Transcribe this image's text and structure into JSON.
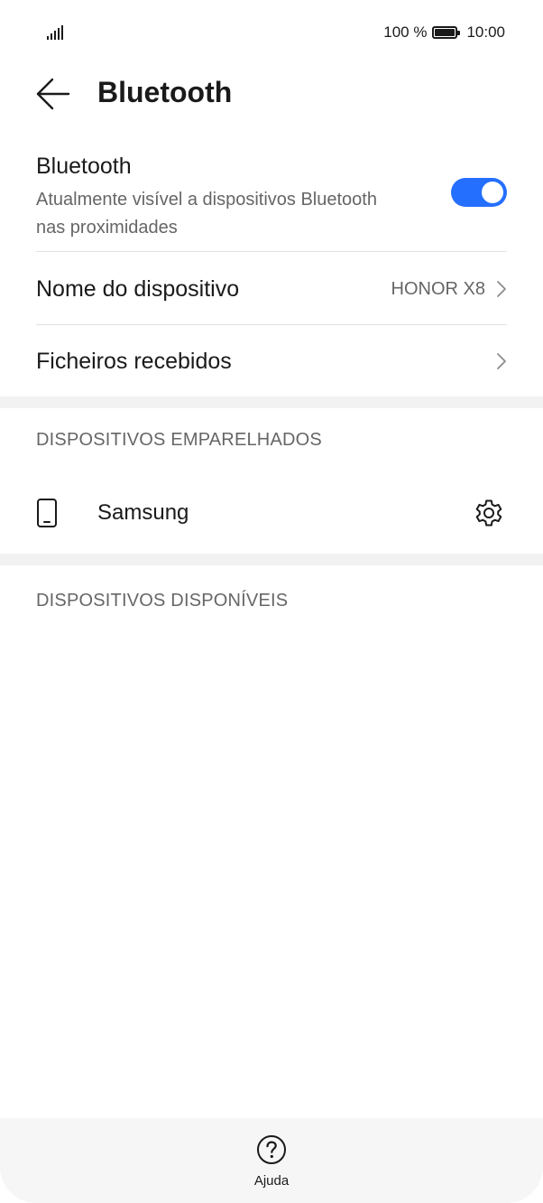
{
  "status_bar": {
    "battery_text": "100 %",
    "time": "10:00"
  },
  "header": {
    "title": "Bluetooth"
  },
  "bluetooth": {
    "title": "Bluetooth",
    "subtitle": "Atualmente visível a dispositivos Bluetooth nas proximidades",
    "enabled": true,
    "accent_color": "#256fff"
  },
  "settings": [
    {
      "label": "Nome do dispositivo",
      "value": "HONOR X8"
    },
    {
      "label": "Ficheiros recebidos",
      "value": ""
    }
  ],
  "paired_section": {
    "title": "DISPOSITIVOS EMPARELHADOS",
    "devices": [
      {
        "name": "Samsung",
        "icon": "phone-icon",
        "action_icon": "gear-icon"
      }
    ]
  },
  "available_section": {
    "title": "DISPOSITIVOS DISPONÍVEIS"
  },
  "bottom_bar": {
    "help_label": "Ajuda",
    "help_icon": "help-circle-icon"
  }
}
